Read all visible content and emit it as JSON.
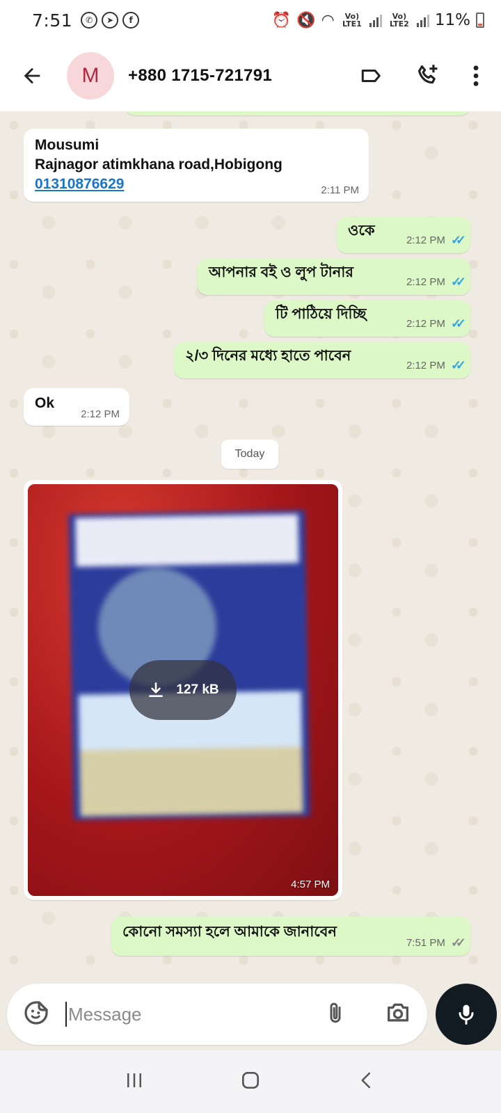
{
  "status_bar": {
    "time": "7:51",
    "sim1_label": "Vo) LTE1",
    "sim2_label": "Vo) LTE2",
    "battery": "11%"
  },
  "header": {
    "avatar_letter": "M",
    "contact": "+880 1715-721791"
  },
  "messages": [
    {
      "dir": "in",
      "lines": [
        "Mousumi",
        "Rajnagor atimkhana road,Hobigong"
      ],
      "link": "01310876629",
      "time": "2:11 PM"
    },
    {
      "dir": "out",
      "text": "ওকে",
      "time": "2:12 PM"
    },
    {
      "dir": "out",
      "text": "আপনার বই ও লুপ টানার",
      "time": "2:12 PM"
    },
    {
      "dir": "out",
      "text": "টি পাঠিয়ে দিচ্ছি",
      "time": "2:12 PM"
    },
    {
      "dir": "out",
      "text": "২/৩ দিনের মধ্যে হাতে পাবেন",
      "time": "2:12 PM"
    },
    {
      "dir": "in",
      "text": "Ok",
      "time": "2:12 PM"
    },
    {
      "dir": "out",
      "text": "কোনো সমস্যা হলে আমাকে জানাবেন",
      "time": "7:51 PM"
    }
  ],
  "date_separator": "Today",
  "image_message": {
    "size": "127 kB",
    "time": "4:57 PM"
  },
  "composer": {
    "placeholder": "Message"
  },
  "icons": {
    "back": "arrow-left-icon",
    "label": "label-icon",
    "add_call": "add-call-icon",
    "menu": "more-vert-icon",
    "sticker": "sticker-icon",
    "attach": "paperclip-icon",
    "camera": "camera-icon",
    "mic": "mic-icon",
    "download": "download-icon"
  },
  "colors": {
    "outgoing_bubble": "#dcf8c6",
    "incoming_bubble": "#ffffff",
    "read_ticks": "#34a3e8",
    "chat_bg": "#efeae2",
    "avatar_bg": "#f7d7d9",
    "avatar_fg": "#b3283f"
  }
}
